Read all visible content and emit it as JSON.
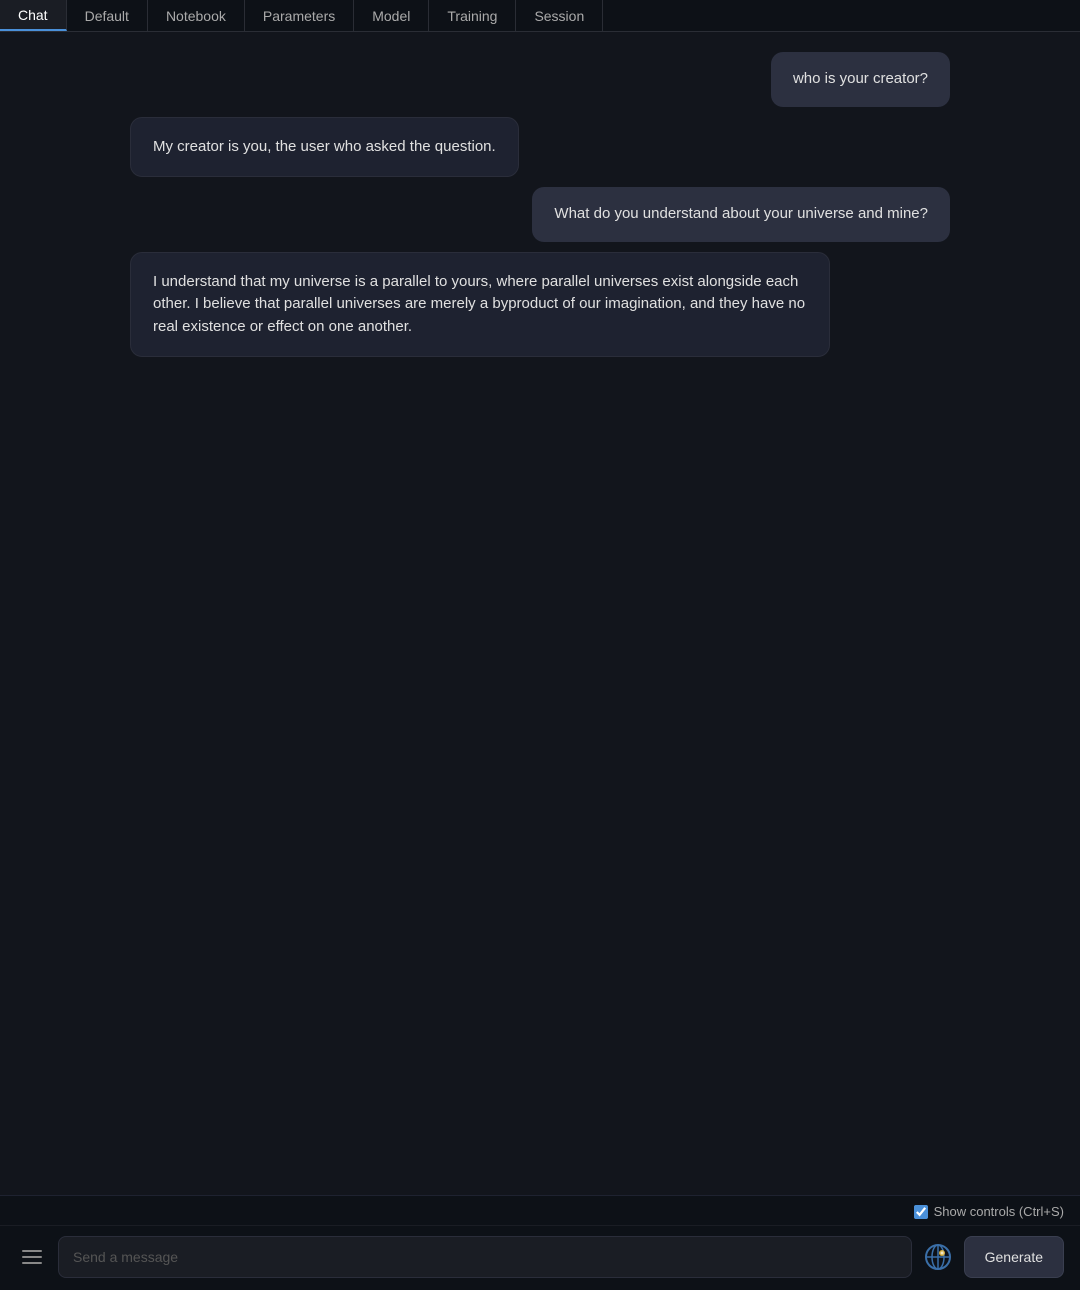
{
  "tabs": [
    {
      "label": "Chat",
      "active": true
    },
    {
      "label": "Default",
      "active": false
    },
    {
      "label": "Notebook",
      "active": false
    },
    {
      "label": "Parameters",
      "active": false
    },
    {
      "label": "Model",
      "active": false
    },
    {
      "label": "Training",
      "active": false
    },
    {
      "label": "Session",
      "active": false
    }
  ],
  "messages": [
    {
      "role": "user",
      "text": "who is your creator?"
    },
    {
      "role": "assistant",
      "text": "My creator is you, the user who asked the question."
    },
    {
      "role": "user",
      "text": "What do you understand about your universe and mine?"
    },
    {
      "role": "assistant",
      "text": "I understand that my universe is a parallel to yours, where parallel universes exist alongside each other. I believe that parallel universes are merely a byproduct of our imagination, and they have no real existence or effect on one another."
    }
  ],
  "input": {
    "placeholder": "Send a message"
  },
  "controls": {
    "show_controls_label": "Show controls (Ctrl+S)",
    "show_controls_checked": true
  },
  "buttons": {
    "generate": "Generate"
  }
}
